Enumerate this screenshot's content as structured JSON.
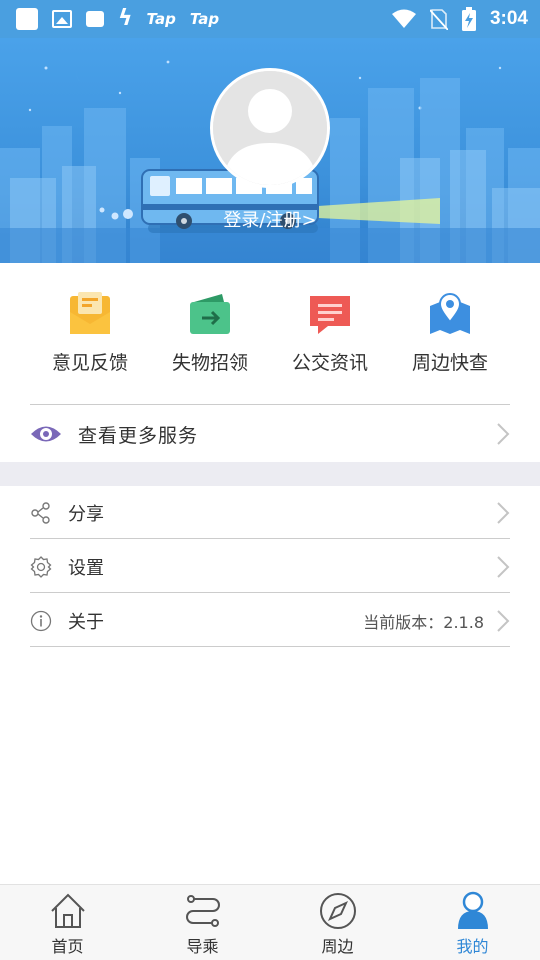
{
  "status_bar": {
    "tap1": "Tap",
    "tap2": "Tap",
    "time": "3:04"
  },
  "header": {
    "login_text": "登录/注册>"
  },
  "quick_actions": [
    {
      "label": "意见反馈",
      "icon": "feedback-envelope-icon",
      "color": "#f7b733"
    },
    {
      "label": "失物招领",
      "icon": "lost-found-wallet-icon",
      "color": "#4cc38a"
    },
    {
      "label": "公交资讯",
      "icon": "message-bubble-icon",
      "color": "#ee5a55"
    },
    {
      "label": "周边快查",
      "icon": "map-pin-icon",
      "color": "#3d8fe0"
    }
  ],
  "more_services": {
    "label": "查看更多服务",
    "icon": "eye-icon",
    "icon_color": "#7a68b8"
  },
  "settings_list": [
    {
      "label": "分享",
      "icon": "share-icon",
      "extra": ""
    },
    {
      "label": "设置",
      "icon": "gear-icon",
      "extra": ""
    },
    {
      "label": "关于",
      "icon": "info-icon",
      "extra": "当前版本：2.1.8"
    }
  ],
  "bottom_nav": [
    {
      "label": "首页",
      "icon": "home-icon",
      "active": false
    },
    {
      "label": "导乘",
      "icon": "route-icon",
      "active": false
    },
    {
      "label": "周边",
      "icon": "compass-icon",
      "active": false
    },
    {
      "label": "我的",
      "icon": "user-icon",
      "active": true
    }
  ],
  "colors": {
    "primary": "#4a9fe0",
    "active_nav": "#2f87d6"
  }
}
